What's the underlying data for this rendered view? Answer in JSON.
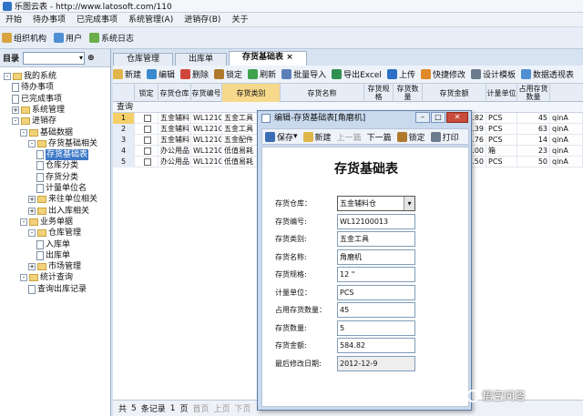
{
  "window": {
    "title": "乐图云表 - http://www.latosoft.com/110"
  },
  "menu": [
    "开始",
    "待办事项",
    "已完成事项",
    "系统管理(A)",
    "进销存(B)",
    "关于"
  ],
  "quick": [
    "组织机构",
    "用户",
    "系统日志"
  ],
  "directory": {
    "label": "目录",
    "filter": "",
    "pin": "⊕"
  },
  "tree": [
    {
      "label": "我的系统",
      "level": 0,
      "kind": "folder",
      "toggle": "-"
    },
    {
      "label": "待办事项",
      "level": 1,
      "kind": "doc",
      "toggle": ""
    },
    {
      "label": "已完成事项",
      "level": 1,
      "kind": "doc",
      "toggle": ""
    },
    {
      "label": "系统管理",
      "level": 1,
      "kind": "folder",
      "toggle": "+"
    },
    {
      "label": "进销存",
      "level": 1,
      "kind": "folder",
      "toggle": "-"
    },
    {
      "label": "基础数据",
      "level": 2,
      "kind": "folder",
      "toggle": "-"
    },
    {
      "label": "存货基础相关",
      "level": 3,
      "kind": "folder",
      "toggle": "-"
    },
    {
      "label": "存货基础表",
      "level": 4,
      "kind": "doc",
      "toggle": "",
      "selected": true
    },
    {
      "label": "仓库分类",
      "level": 4,
      "kind": "doc",
      "toggle": ""
    },
    {
      "label": "存货分类",
      "level": 4,
      "kind": "doc",
      "toggle": ""
    },
    {
      "label": "计量单位名",
      "level": 4,
      "kind": "doc",
      "toggle": ""
    },
    {
      "label": "来往单位相关",
      "level": 3,
      "kind": "folder",
      "toggle": "+"
    },
    {
      "label": "出入库相关",
      "level": 3,
      "kind": "folder",
      "toggle": "+"
    },
    {
      "label": "业务单据",
      "level": 2,
      "kind": "folder",
      "toggle": "-"
    },
    {
      "label": "仓库管理",
      "level": 3,
      "kind": "folder",
      "toggle": "-"
    },
    {
      "label": "入库单",
      "level": 4,
      "kind": "doc",
      "toggle": ""
    },
    {
      "label": "出库单",
      "level": 4,
      "kind": "doc",
      "toggle": ""
    },
    {
      "label": "市场管理",
      "level": 3,
      "kind": "folder",
      "toggle": "+"
    },
    {
      "label": "统计查询",
      "level": 2,
      "kind": "folder",
      "toggle": "-"
    },
    {
      "label": "查询出库记录",
      "level": 3,
      "kind": "doc",
      "toggle": ""
    }
  ],
  "tabs": [
    {
      "label": "仓库管理",
      "active": false
    },
    {
      "label": "出库单",
      "active": false
    },
    {
      "label": "存货基础表",
      "active": true,
      "close": "×"
    }
  ],
  "toolbar": [
    "新建",
    "编辑",
    "删除",
    "锁定",
    "刷新",
    "批量导入",
    "导出Excel",
    "上传",
    "快捷修改",
    "设计模板",
    "数据透视表"
  ],
  "grid": {
    "headers": [
      "",
      "锁定",
      "存货仓库",
      "存货编号",
      "存货类别",
      "存货名称",
      "存货规格",
      "存货数量",
      "存货金额",
      "计量单位",
      "占用存货数量"
    ],
    "query_label": "查询",
    "rows": [
      [
        "1",
        "",
        "五金辅料",
        "WL12100",
        "五金工具",
        "",
        "",
        "",
        "584.82",
        "PCS",
        "45"
      ],
      [
        "2",
        "",
        "五金辅料",
        "WL12100",
        "五金工具",
        "",
        "",
        "",
        "1139.39",
        "PCS",
        "63"
      ],
      [
        "3",
        "",
        "五金辅料",
        "WL12100",
        "五金配件",
        "",
        "",
        "",
        "1000.76",
        "PCS",
        "14"
      ],
      [
        "4",
        "",
        "办公用品",
        "WL12100",
        "低值易耗",
        "",
        "",
        "",
        "455.00",
        "箱",
        "23"
      ],
      [
        "5",
        "",
        "办公用品",
        "WL12100",
        "低值易耗",
        "",
        "",
        "",
        "1967.50",
        "PCS",
        "50"
      ]
    ],
    "tail": [
      "qinA",
      "qinA",
      "qinA",
      "qinA",
      "qinA"
    ]
  },
  "pager": [
    "共",
    "5",
    "条记录",
    "1",
    "页",
    "首页",
    "上页",
    "下页"
  ],
  "dialog": {
    "title": "编辑-存货基础表[角磨机]",
    "toolbar": [
      "保存",
      "新建",
      "上一篇",
      "下一篇",
      "锁定",
      "打印"
    ],
    "form_title": "存货基础表",
    "fields": [
      {
        "label": "存货仓库：",
        "value": "五金辅料仓",
        "type": "select"
      },
      {
        "label": "存货编号:",
        "value": "WL12100013"
      },
      {
        "label": "存货类别:",
        "value": "五金工具"
      },
      {
        "label": "存货名称:",
        "value": "角磨机"
      },
      {
        "label": "存货规格:",
        "value": "12 \""
      },
      {
        "label": "计量单位：",
        "value": "PCS"
      },
      {
        "label": "占用存货数量：",
        "value": "45"
      },
      {
        "label": "存货数量:",
        "value": "5"
      },
      {
        "label": "存货金额:",
        "value": "584.82"
      },
      {
        "label": "最后修改日期:",
        "value": "2012-12-9",
        "gray": true
      }
    ]
  },
  "watermark": "悟空问答"
}
